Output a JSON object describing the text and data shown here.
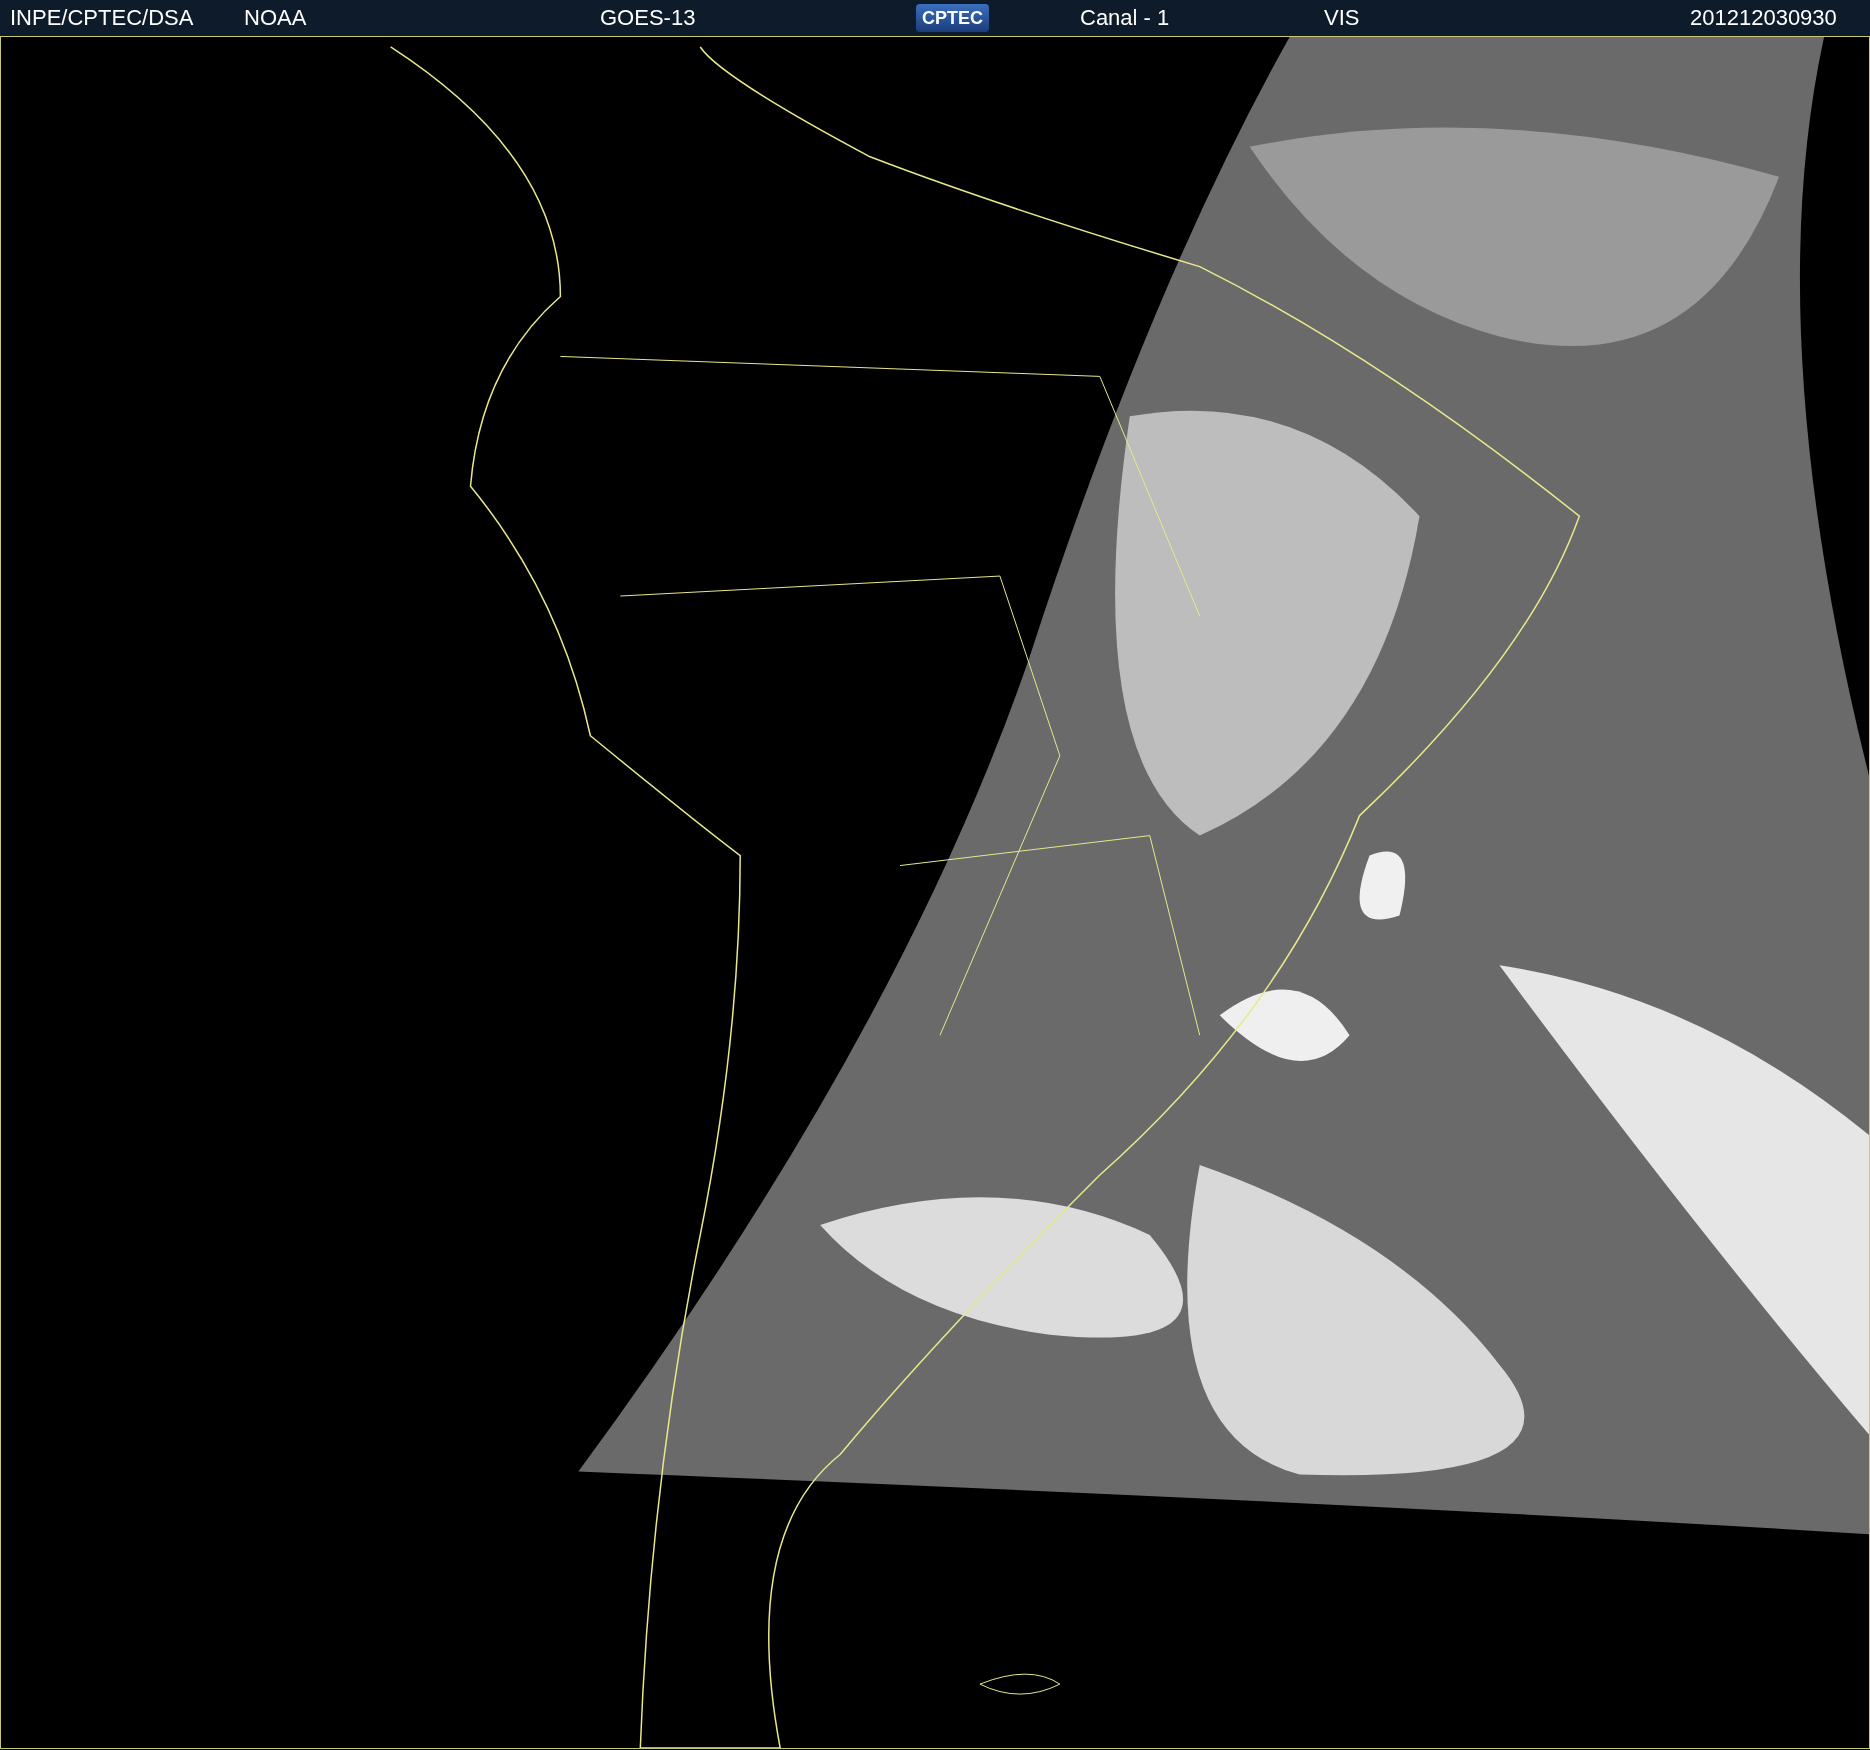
{
  "header": {
    "items": [
      {
        "kind": "text",
        "text": "INPE/CPTEC/DSA"
      },
      {
        "kind": "text",
        "text": "NOAA"
      },
      {
        "kind": "text",
        "text": "GOES-13"
      },
      {
        "kind": "logo",
        "text": "CPTEC"
      },
      {
        "kind": "text",
        "text": "Canal - 1"
      },
      {
        "kind": "text",
        "text": "VIS"
      },
      {
        "kind": "text",
        "text": "201212030930"
      }
    ]
  }
}
